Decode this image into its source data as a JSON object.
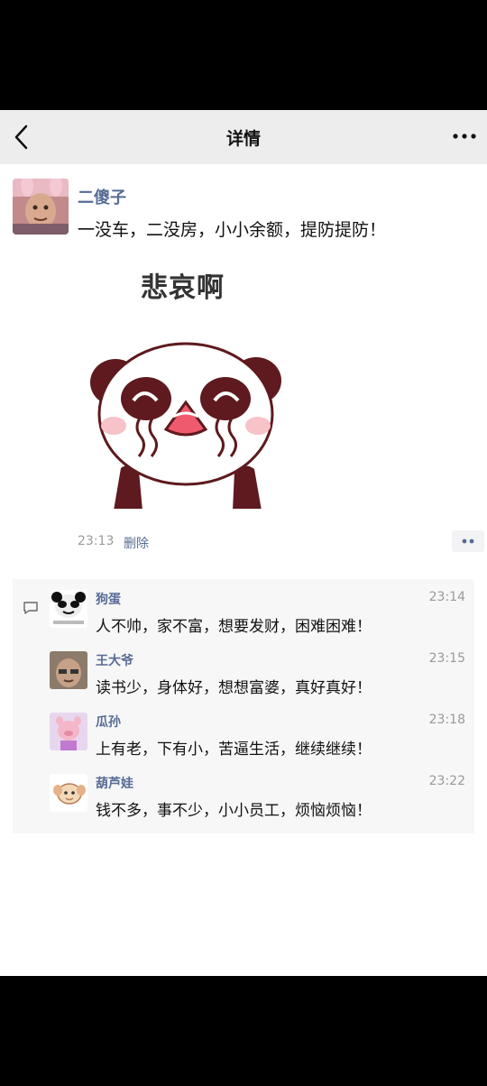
{
  "header": {
    "title": "详情",
    "back_icon": "chevron-left-icon",
    "more_icon": "more-dots-icon"
  },
  "post": {
    "author": "二傻子",
    "text": "一没车，二没房，小小余额，提防提防！",
    "sticker_caption": "悲哀啊",
    "time": "23:13",
    "delete_label": "删除"
  },
  "comments": [
    {
      "name": "狗蛋",
      "time": "23:14",
      "text": "人不帅，家不富，想要发财，困难困难！"
    },
    {
      "name": "王大爷",
      "time": "23:15",
      "text": "读书少，身体好，想想富婆，真好真好！"
    },
    {
      "name": "瓜孙",
      "time": "23:18",
      "text": "上有老，下有小，苦逼生活，继续继续！"
    },
    {
      "name": "葫芦娃",
      "time": "23:22",
      "text": "钱不多，事不少，小小员工，烦恼烦恼！"
    }
  ],
  "colors": {
    "link": "#576b95",
    "nav_bg": "#ededed",
    "comment_bg": "#f7f7f7"
  }
}
